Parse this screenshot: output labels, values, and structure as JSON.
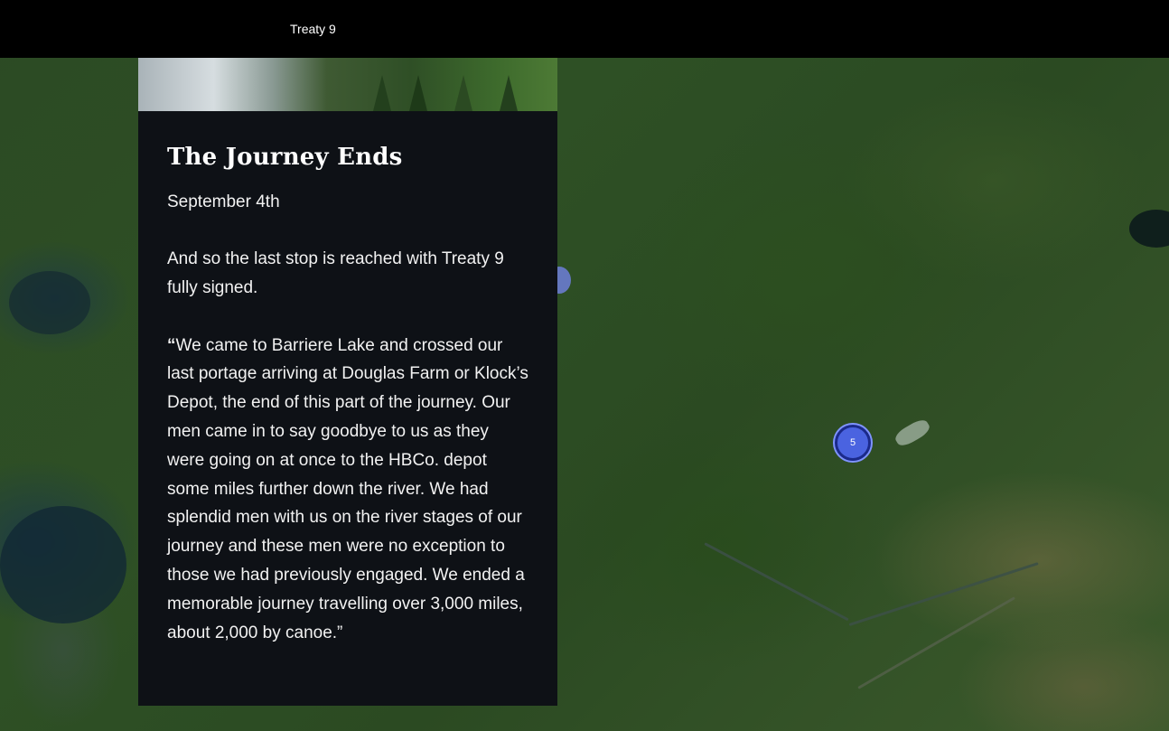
{
  "topbar": {
    "title": "Treaty 9"
  },
  "panel": {
    "title": "The Journey Ends",
    "date": "September 4th",
    "paragraph": "And so the last stop is reached with Treaty 9 fully signed.",
    "quote_mark": "“",
    "quote": "We came to Barriere Lake and crossed our last portage arriving at Douglas Farm or Klock’s Depot, the end of this part of the journey. Our men came in to say goodbye to us as they were going on at once to the HBCo. depot some miles further down the river. We had splendid men with us on the river stages of our journey and these men were no exception to those we had previously engaged. We ended a memorable journey travelling over 3,000 miles, about 2,000 by canoe.”"
  },
  "map": {
    "clusters": [
      {
        "count": "5"
      }
    ],
    "colors": {
      "cluster_fill": "#4a63e0",
      "cluster_border": "#1b2a8a",
      "panel_bg": "#0e1116",
      "topbar_bg": "#000000"
    }
  }
}
